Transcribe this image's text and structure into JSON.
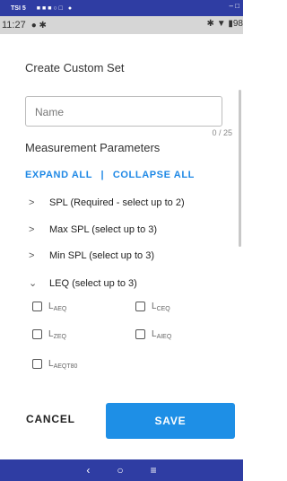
{
  "emulator": {
    "title": "TSI 5",
    "dots": "■■■○□ ●",
    "controls": "– □"
  },
  "status": {
    "time": "11:27",
    "left_icons": "● ✱",
    "right_icons": "✱ ▼ ▮98"
  },
  "screen": {
    "title": "Create Custom Set",
    "name_placeholder": "Name",
    "counter": "0 / 25",
    "section_title": "Measurement Parameters",
    "expand_all": "EXPAND ALL",
    "separator": "|",
    "collapse_all": "COLLAPSE ALL",
    "params": [
      {
        "chevron": ">",
        "label": "SPL (Required - select up to 2)"
      },
      {
        "chevron": ">",
        "label": "Max SPL (select up to 3)"
      },
      {
        "chevron": ">",
        "label": "Min SPL (select up to 3)"
      },
      {
        "chevron": "⌄",
        "label": "LEQ (select up to 3)"
      }
    ],
    "checkboxes": [
      {
        "base": "L",
        "sub": "AEQ"
      },
      {
        "base": "L",
        "sub": "CEQ"
      },
      {
        "base": "L",
        "sub": "ZEQ"
      },
      {
        "base": "L",
        "sub": "AIEQ"
      },
      {
        "base": "L",
        "sub": "AEQT80"
      }
    ],
    "cancel": "CANCEL",
    "save": "SAVE"
  },
  "nav": {
    "back": "‹",
    "home": "○",
    "recents": "≡"
  },
  "colors": {
    "accent": "#1e88e5",
    "emulator_bar": "#2f3da3"
  }
}
